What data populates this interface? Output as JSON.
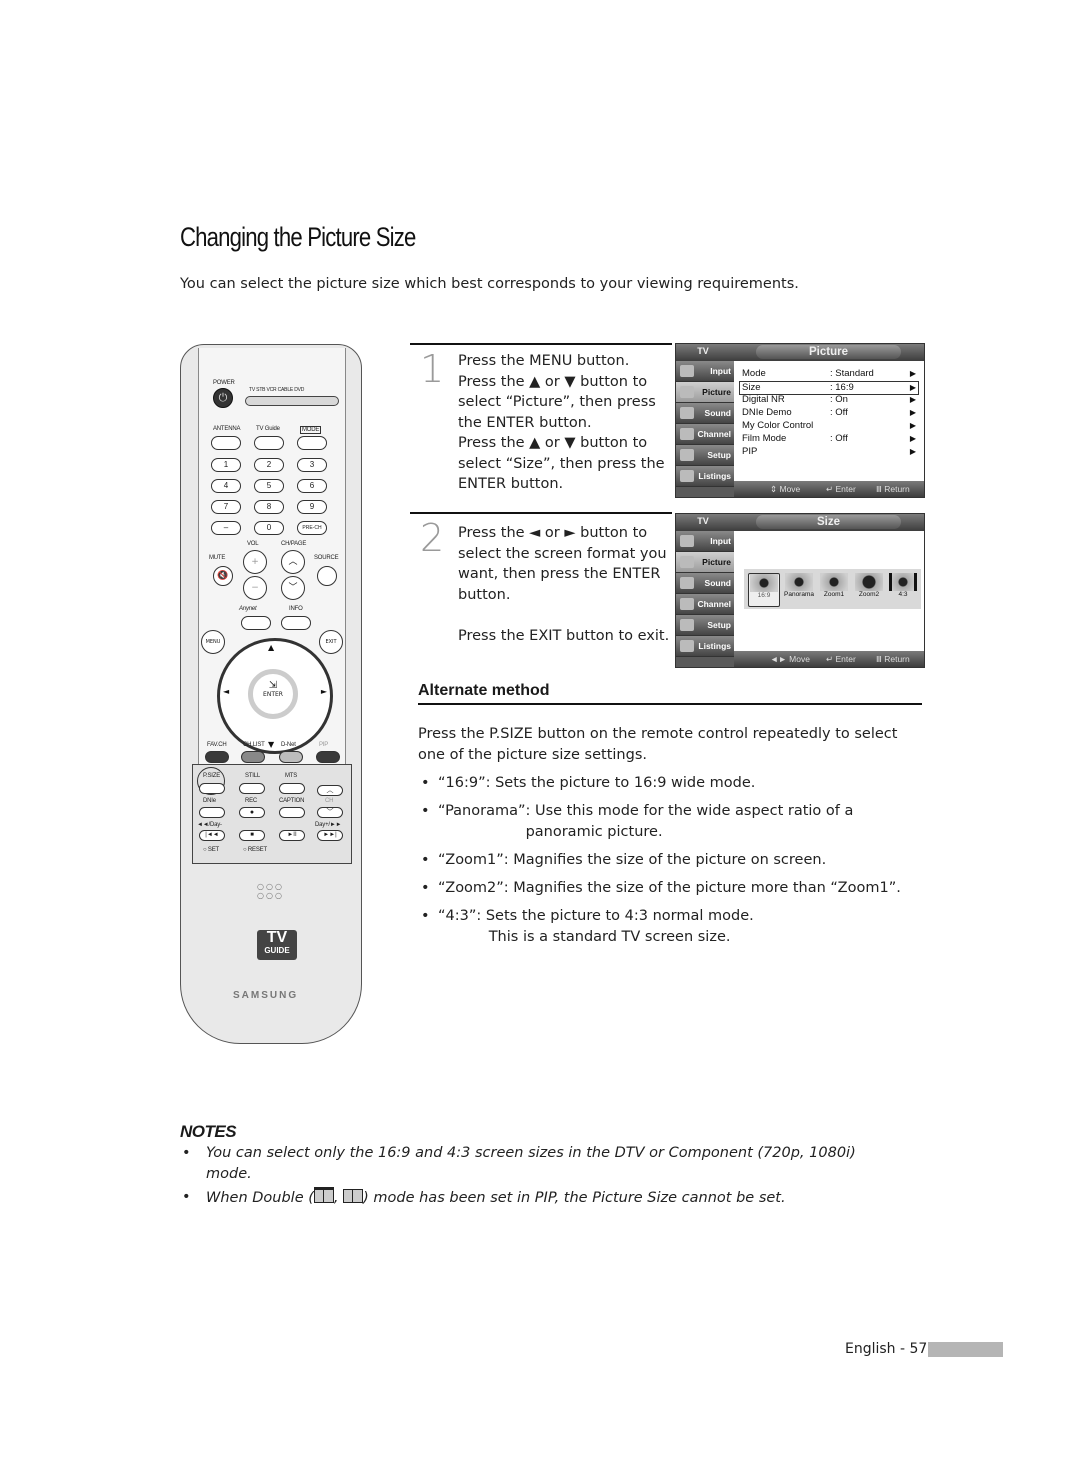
{
  "page": {
    "title": "Changing the Picture Size",
    "intro": "You can select the picture size which best corresponds to your viewing requirements."
  },
  "remote": {
    "power_label": "POWER",
    "mode_labels": "TV  STB  VCR  CABLE  DVD",
    "row1": [
      "ANTENNA",
      "TV Guide",
      "MODE"
    ],
    "numbers": [
      "1",
      "2",
      "3",
      "4",
      "5",
      "6",
      "7",
      "8",
      "9",
      "–",
      "0",
      "PRE-CH"
    ],
    "vol_label": "VOL",
    "ch_label": "CH/PAGE",
    "mute_label": "MUTE",
    "source_label": "SOURCE",
    "anynet_label": "Anynet",
    "info_label": "INFO",
    "menu_label": "MENU",
    "exit_label": "EXIT",
    "enter_label": "ENTER",
    "color_row": [
      "FAV.CH",
      "CH.LIST",
      "D-Net",
      "PIP"
    ],
    "lower_row1": [
      "P.SIZE",
      "STILL",
      "MTS"
    ],
    "lower_row2": [
      "DNIe",
      "REC",
      "CAPTION",
      "CH"
    ],
    "rew_label": "◄◄/Day-",
    "ff_label": "Day+/►►",
    "set_label": "SET",
    "reset_label": "RESET",
    "tvguide_top": "TV",
    "tvguide_bottom": "GUIDE",
    "brand": "SAMSUNG"
  },
  "steps": [
    {
      "number": "1",
      "text": "Press the MENU button.\nPress the ▲ or ▼ button to\nselect “Picture”, then press\nthe ENTER button.\nPress the ▲ or ▼ button to\nselect “Size”, then press the\nENTER button."
    },
    {
      "number": "2",
      "text": "Press the ◄ or ► button to\nselect the screen format you\nwant, then press the ENTER\nbutton.\n\nPress the EXIT button to exit."
    }
  ],
  "osd_common": {
    "tv_label": "TV",
    "sidebar": [
      "Input",
      "Picture",
      "Sound",
      "Channel",
      "Setup",
      "Listings"
    ],
    "footer": {
      "move": "⇕ Move",
      "move_lr": "◄► Move",
      "enter": "↵ Enter",
      "return": "Ⅲ Return"
    }
  },
  "osd_picture": {
    "title": "Picture",
    "active_sidebar": "Picture",
    "rows": [
      {
        "label": "Mode",
        "value": ": Standard",
        "selected": false
      },
      {
        "label": "Size",
        "value": ": 16:9",
        "selected": true
      },
      {
        "label": "Digital NR",
        "value": ": On",
        "selected": false
      },
      {
        "label": "DNIe Demo",
        "value": ": Off",
        "selected": false
      },
      {
        "label": "My Color Control",
        "value": "",
        "selected": false
      },
      {
        "label": "Film Mode",
        "value": ": Off",
        "selected": false
      },
      {
        "label": "PIP",
        "value": "",
        "selected": false
      }
    ]
  },
  "osd_size": {
    "title": "Size",
    "active_sidebar": "Picture",
    "options": [
      "16:9",
      "Panorama",
      "Zoom1",
      "Zoom2",
      "4:3"
    ],
    "selected": "16:9"
  },
  "alternate": {
    "heading": "Alternate method",
    "paragraph": "Press the P.SIZE button on the remote control repeatedly to select one of the picture size settings.",
    "bullets": [
      "“16:9”: Sets the picture to 16:9 wide mode.",
      "“Panorama”: Use this mode for the wide aspect ratio of a\n                   panoramic picture.",
      "“Zoom1”: Magnifies the size of the picture on screen.",
      "“Zoom2”: Magnifies the size of the picture more than “Zoom1”.",
      "“4:3”: Sets the picture to 4:3 normal mode.\n           This is a standard TV screen size."
    ]
  },
  "notes": {
    "heading": "NOTES",
    "items": [
      "You can select only the 16:9 and 4:3 screen sizes in the DTV or Component (720p, 1080i) mode.",
      {
        "before": "When Double (",
        "sep": ", ",
        "after": ") mode has been set in PIP, the Picture Size cannot be set."
      }
    ]
  },
  "footer": {
    "page_label": "English - 57"
  }
}
